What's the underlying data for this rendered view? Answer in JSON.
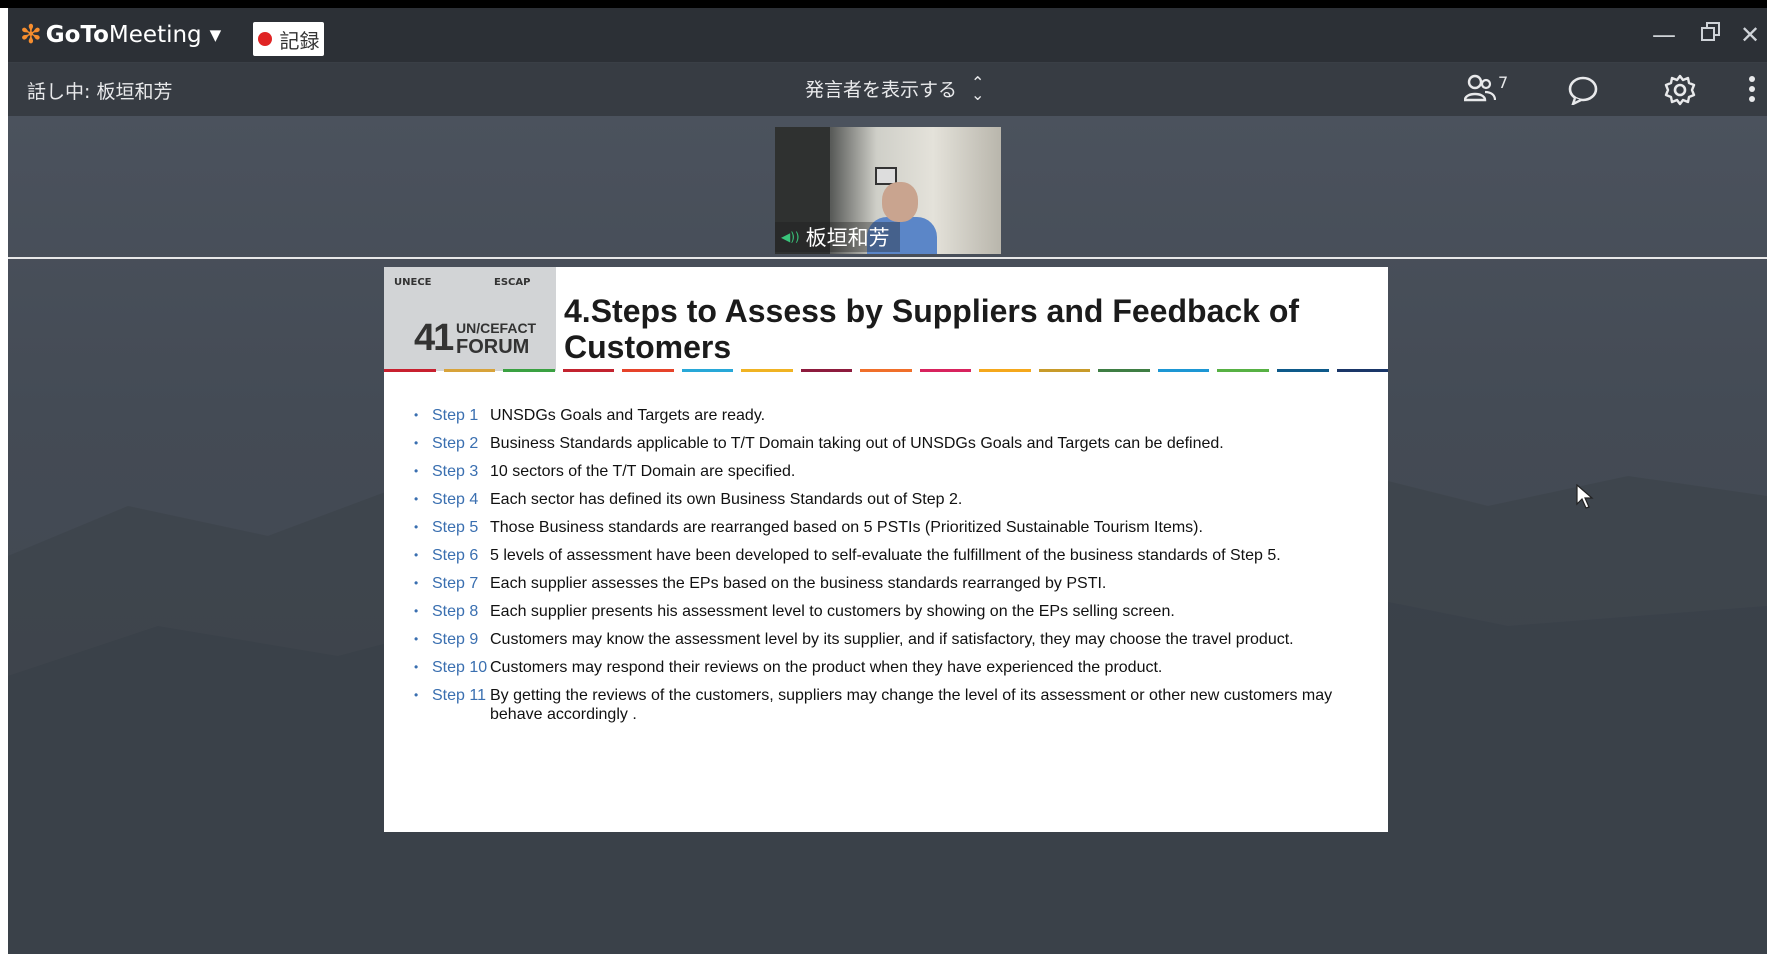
{
  "app": {
    "brand_bold": "GoTo",
    "brand_light": "Meeting",
    "record_label": "記録"
  },
  "subbar": {
    "speaking_label": "話し中: 板垣和芳",
    "speaker_view_label": "発言者を表示する",
    "attendee_count": "7"
  },
  "video": {
    "participant_name": "板垣和芳"
  },
  "slide": {
    "logo_left": "UNECE",
    "logo_right": "ESCAP",
    "forum_number": "41",
    "forum_org": "UN/CEFACT",
    "forum_word": "FORUM",
    "title": "4.Steps to Assess by Suppliers and Feedback of Customers",
    "rule_colors": [
      "#c8202f",
      "#d8a33a",
      "#3aa142",
      "#c3232f",
      "#e6432a",
      "#28a8d8",
      "#f0b323",
      "#8d1b3d",
      "#f06f2a",
      "#d8235e",
      "#f5a81c",
      "#c89b2a",
      "#3f7e44",
      "#1d97d4",
      "#57b144",
      "#0e5a8a",
      "#1a3668"
    ],
    "steps": [
      {
        "step": "Step 1",
        "text": "UNSDGs Goals and Targets are ready."
      },
      {
        "step": "Step 2",
        "text": "Business Standards applicable to T/T Domain taking out of UNSDGs Goals and Targets can be defined."
      },
      {
        "step": "Step 3",
        "text": "10 sectors of the T/T Domain are specified."
      },
      {
        "step": "Step 4",
        "text": "Each sector has defined its own Business Standards out of Step 2."
      },
      {
        "step": "Step 5",
        "text": "Those Business standards are rearranged based on 5 PSTIs  (Prioritized Sustainable Tourism Items)."
      },
      {
        "step": "Step 6",
        "text": "5 levels of assessment have been developed to self-evaluate the fulfillment of the business standards of Step 5."
      },
      {
        "step": "Step 7",
        "text": "Each supplier assesses the EPs based on the business standards rearranged by PSTI."
      },
      {
        "step": "Step 8",
        "text": "Each supplier presents his assessment level to customers by showing on the EPs selling screen."
      },
      {
        "step": "Step 9",
        "text": "Customers may know the assessment level by its supplier, and if satisfactory, they may choose the travel product."
      },
      {
        "step": "Step 10",
        "text": "Customers may respond their reviews on the product when they have experienced the product."
      },
      {
        "step": "Step 11",
        "text": "By getting the reviews of the customers, suppliers may change the level of its assessment or other new customers may behave accordingly ."
      }
    ]
  }
}
